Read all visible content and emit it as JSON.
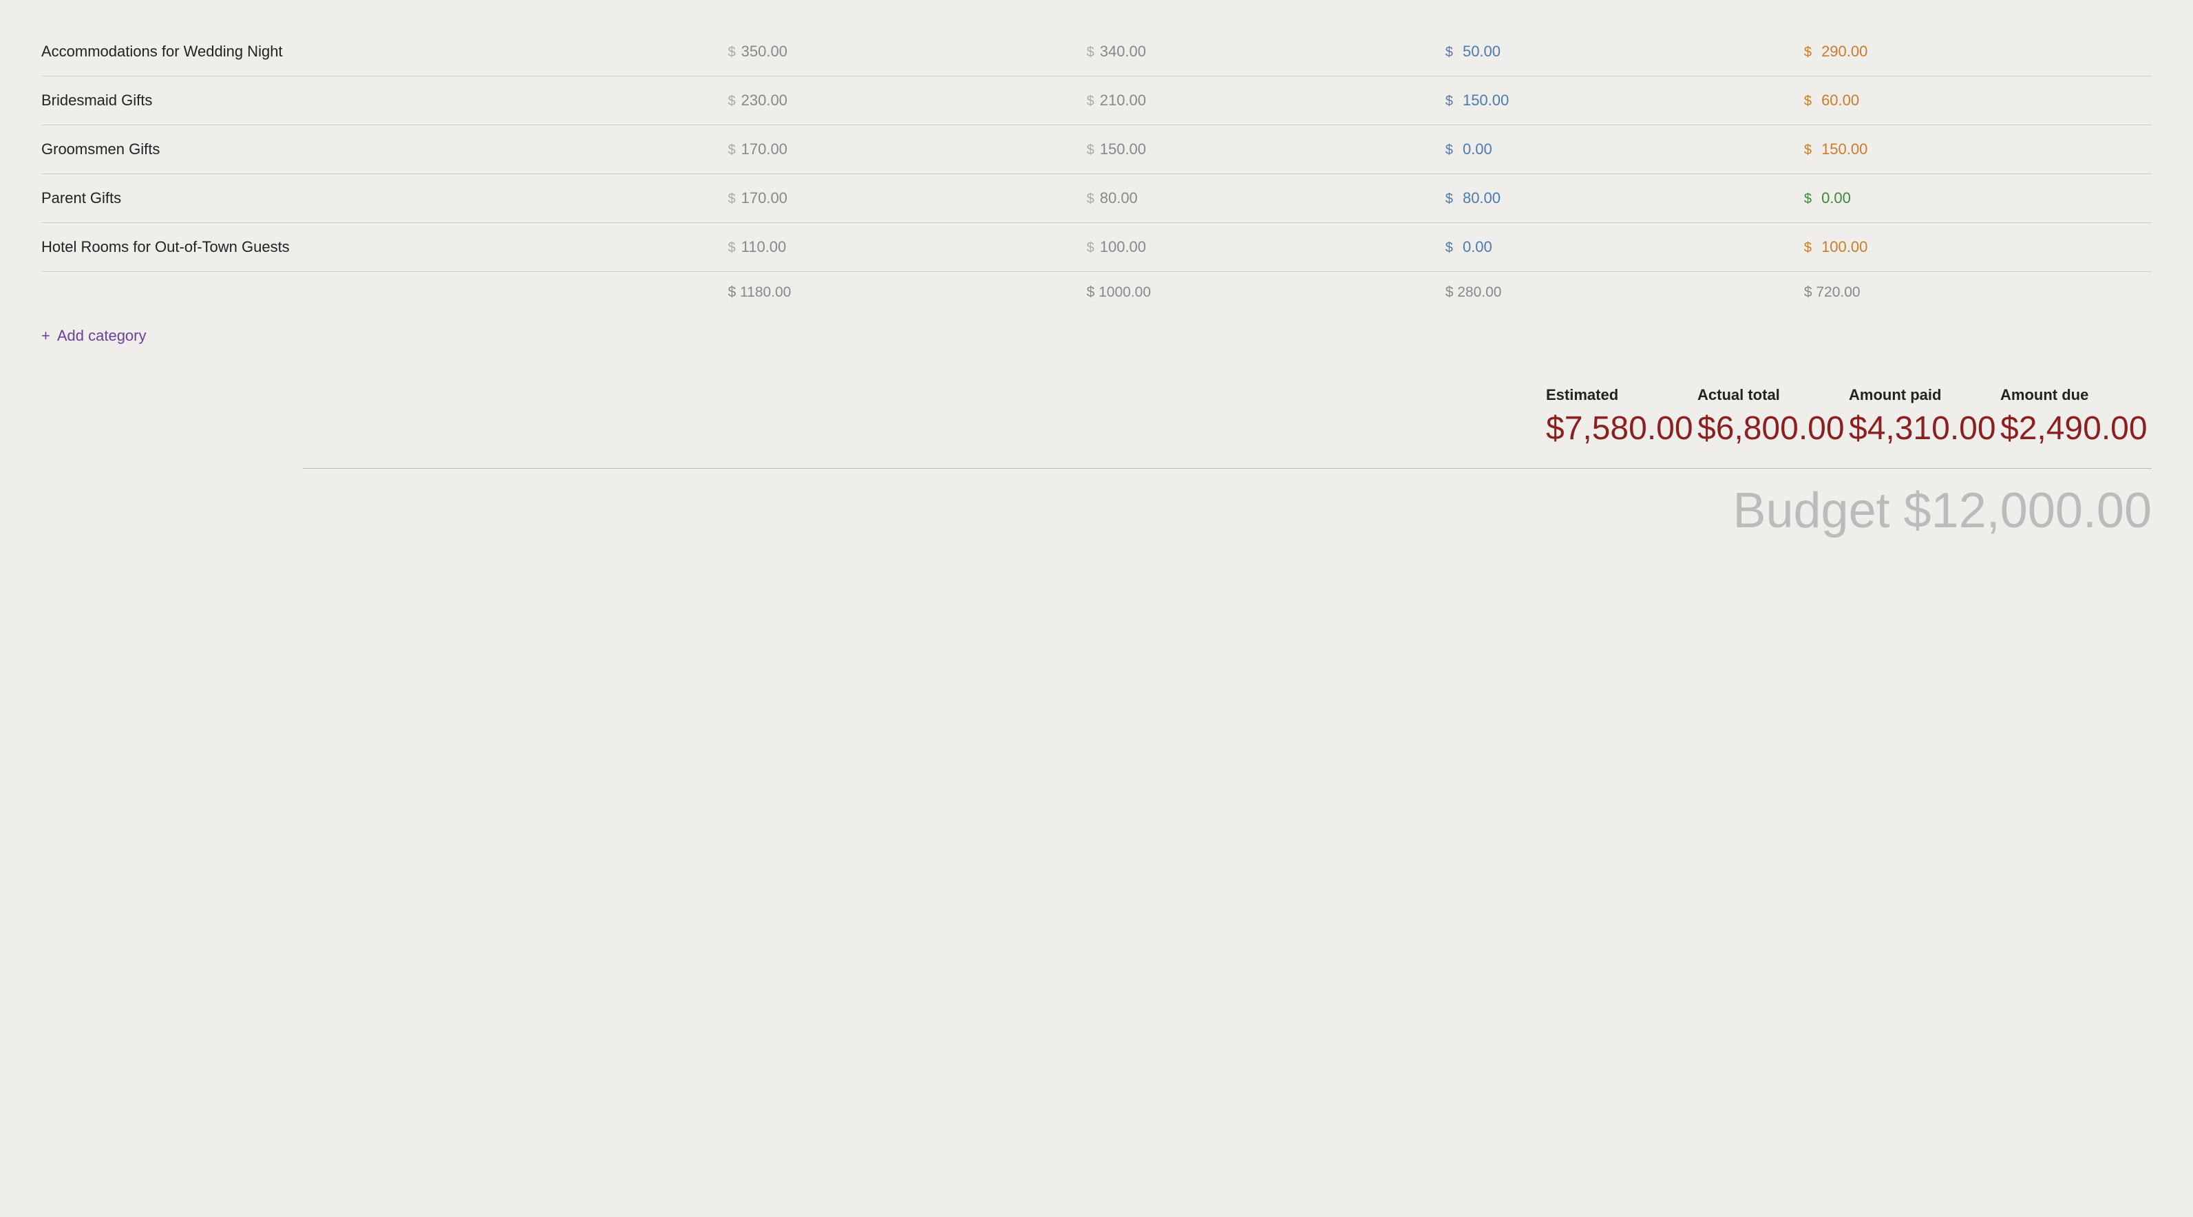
{
  "colors": {
    "blue": "#4a7ab5",
    "orange": "#c87d2a",
    "green": "#3a8a3a",
    "purple": "#6a3fa0",
    "dark_red": "#8b2020",
    "gray": "#888888"
  },
  "rows": [
    {
      "label": "Accommodations for Wedding Night",
      "estimated": "350.00",
      "actual": "340.00",
      "paid": "50.00",
      "paid_color": "blue",
      "due": "290.00",
      "due_color": "orange"
    },
    {
      "label": "Bridesmaid Gifts",
      "estimated": "230.00",
      "actual": "210.00",
      "paid": "150.00",
      "paid_color": "blue",
      "due": "60.00",
      "due_color": "orange"
    },
    {
      "label": "Groomsmen Gifts",
      "estimated": "170.00",
      "actual": "150.00",
      "paid": "0.00",
      "paid_color": "blue",
      "due": "150.00",
      "due_color": "orange"
    },
    {
      "label": "Parent Gifts",
      "estimated": "170.00",
      "actual": "80.00",
      "paid": "80.00",
      "paid_color": "blue",
      "due": "0.00",
      "due_color": "green"
    },
    {
      "label": "Hotel Rooms for Out-of-Town Guests",
      "estimated": "110.00",
      "actual": "100.00",
      "paid": "0.00",
      "paid_color": "blue",
      "due": "100.00",
      "due_color": "orange"
    }
  ],
  "totals": {
    "estimated": "$ 1180.00",
    "actual": "$ 1000.00",
    "paid": "$ 280.00",
    "due": "$ 720.00"
  },
  "add_category_label": "Add category",
  "summary": {
    "estimated_label": "Estimated",
    "estimated_value": "$7,580.00",
    "actual_label": "Actual total",
    "actual_value": "$6,800.00",
    "paid_label": "Amount paid",
    "paid_value": "$4,310.00",
    "due_label": "Amount due",
    "due_value": "$2,490.00"
  },
  "budget_label": "Budget $12,000.00"
}
